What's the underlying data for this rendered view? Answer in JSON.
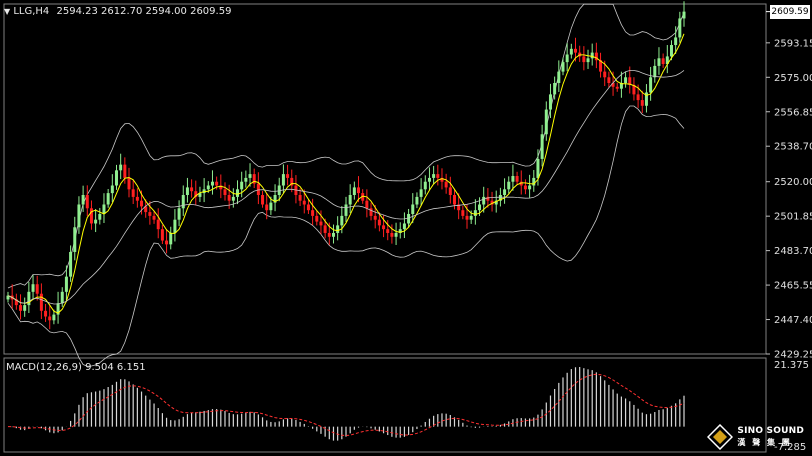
{
  "header": {
    "symbol": "LLG,H4",
    "ohlc": "2594.23 2612.70 2594.00 2609.59",
    "macd_label": "MACD(12,26,9) 9.504 6.151"
  },
  "current_price": "2609.59",
  "price_axis_labels": [
    "2593.15",
    "2575.00",
    "2556.85",
    "2538.70",
    "2520.00",
    "2501.85",
    "2483.70",
    "2465.55",
    "2447.40",
    "2429.25"
  ],
  "macd_axis_labels": [
    "21.375",
    "-7.285"
  ],
  "brand": {
    "name": "SINO SOUND",
    "sub": "漢 聲 集 團"
  },
  "colors": {
    "up": "#90ee90",
    "down": "#ff2020",
    "ma": "#ffff00",
    "band": "#c8c8c8",
    "signal": "#ff3030",
    "hist": "#d8d8d8"
  },
  "chart_data": [
    {
      "type": "candlestick",
      "title": "LLG,H4",
      "ylim": [
        2429.25,
        2611.5
      ],
      "ticks": [
        2593.15,
        2575.0,
        2556.85,
        2538.7,
        2520.0,
        2501.85,
        2483.7,
        2465.55,
        2447.4,
        2429.25
      ],
      "price_path": [
        2460,
        2458,
        2455,
        2452,
        2455,
        2462,
        2466,
        2461,
        2452,
        2449,
        2447,
        2450,
        2456,
        2462,
        2470,
        2483,
        2496,
        2508,
        2513,
        2506,
        2498,
        2500,
        2503,
        2508,
        2514,
        2518,
        2526,
        2529,
        2522,
        2516,
        2512,
        2510,
        2507,
        2504,
        2502,
        2500,
        2495,
        2489,
        2487,
        2493,
        2500,
        2506,
        2513,
        2517,
        2515,
        2512,
        2514,
        2516,
        2518,
        2520,
        2518,
        2516,
        2513,
        2510,
        2512,
        2516,
        2520,
        2522,
        2524,
        2519,
        2513,
        2508,
        2505,
        2509,
        2513,
        2518,
        2524,
        2522,
        2518,
        2513,
        2510,
        2508,
        2505,
        2502,
        2499,
        2497,
        2493,
        2491,
        2493,
        2497,
        2502,
        2508,
        2513,
        2517,
        2514,
        2510,
        2506,
        2502,
        2500,
        2497,
        2495,
        2493,
        2491,
        2493,
        2495,
        2498,
        2503,
        2508,
        2512,
        2516,
        2520,
        2522,
        2524,
        2522,
        2520,
        2517,
        2513,
        2508,
        2505,
        2502,
        2500,
        2502,
        2505,
        2508,
        2512,
        2510,
        2508,
        2510,
        2513,
        2516,
        2520,
        2523,
        2520,
        2518,
        2516,
        2518,
        2522,
        2532,
        2545,
        2558,
        2566,
        2572,
        2578,
        2583,
        2587,
        2590,
        2588,
        2586,
        2583,
        2585,
        2588,
        2584,
        2578,
        2575,
        2572,
        2570,
        2569,
        2572,
        2575,
        2571,
        2566,
        2563,
        2560,
        2567,
        2575,
        2581,
        2585,
        2582,
        2586,
        2592,
        2596,
        2606,
        2609.59
      ],
      "indicators": [
        "Bollinger Bands",
        "Moving Average"
      ]
    },
    {
      "type": "bar",
      "title": "MACD(12,26,9)",
      "series": [
        {
          "name": "MACD",
          "value": 9.504
        },
        {
          "name": "Signal",
          "value": 6.151
        }
      ],
      "ylim": [
        -7.285,
        21.375
      ]
    }
  ]
}
